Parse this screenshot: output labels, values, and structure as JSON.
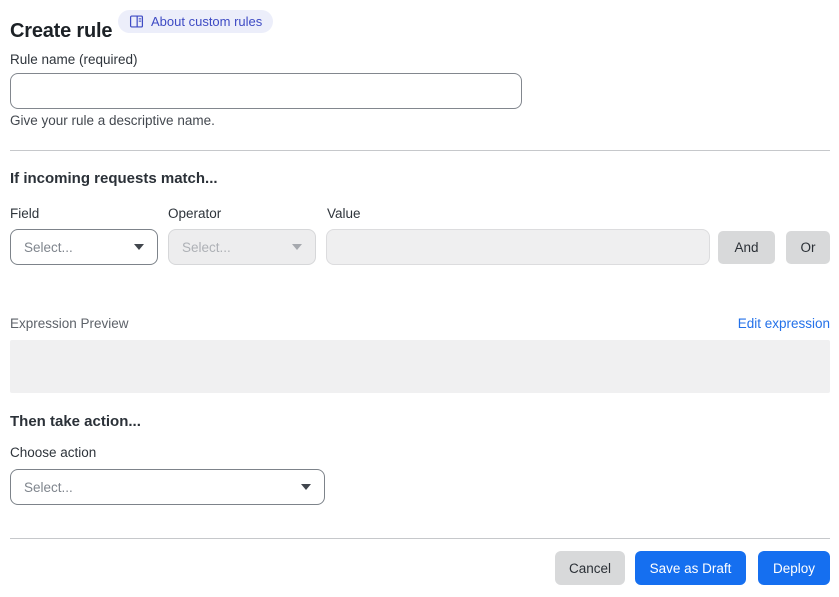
{
  "header": {
    "title": "Create rule",
    "about_link": "About custom rules"
  },
  "rule_name": {
    "label": "Rule name (required)",
    "value": "",
    "helper": "Give your rule a descriptive name."
  },
  "match": {
    "heading": "If incoming requests match...",
    "field_label": "Field",
    "operator_label": "Operator",
    "value_label": "Value",
    "field_placeholder": "Select...",
    "operator_placeholder": "Select...",
    "value_text": "",
    "and_label": "And",
    "or_label": "Or"
  },
  "expression": {
    "preview_label": "Expression Preview",
    "edit_link": "Edit expression",
    "preview_text": ""
  },
  "action": {
    "heading": "Then take action...",
    "label": "Choose action",
    "placeholder": "Select..."
  },
  "footer": {
    "cancel_label": "Cancel",
    "save_draft_label": "Save as Draft",
    "deploy_label": "Deploy"
  },
  "colors": {
    "primary_button_blue": "#156FF0",
    "link_blue": "#2371E9",
    "badge_background": "#ECEEFA",
    "badge_text": "#3E4BC4",
    "disabled_field_bg": "#EDEDEE",
    "preview_box_bg": "#F0F0F1"
  }
}
